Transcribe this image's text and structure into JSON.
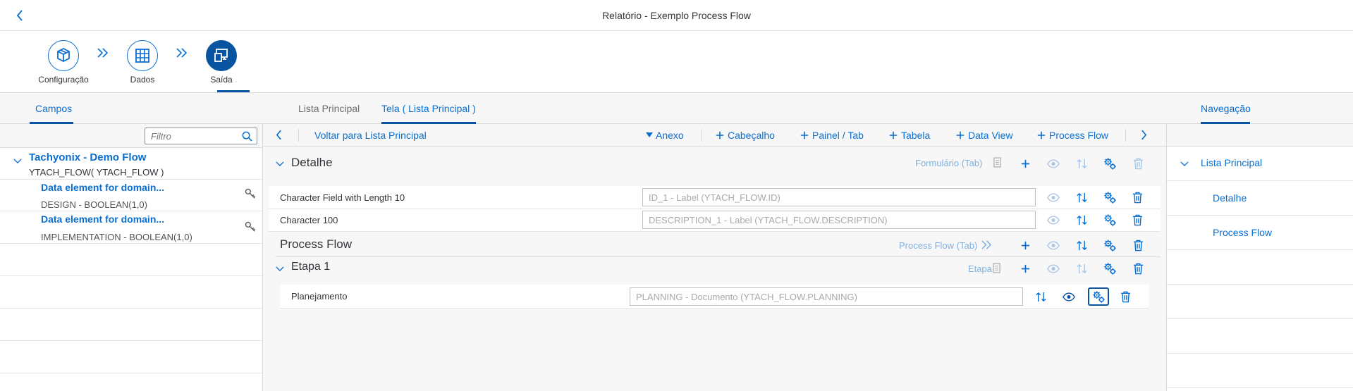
{
  "shell": {
    "title": "Relatório - Exemplo Process Flow"
  },
  "wizard": {
    "steps": [
      {
        "label": "Configuração",
        "icon": "package-icon"
      },
      {
        "label": "Dados",
        "icon": "table-grid-icon"
      },
      {
        "label": "Saída",
        "icon": "display-output-icon",
        "active": true
      }
    ]
  },
  "tabs": {
    "left": "Campos",
    "center": [
      "Lista Principal",
      "Tela ( Lista Principal )"
    ],
    "right": "Navegação"
  },
  "left_panel": {
    "filter_placeholder": "Filtro",
    "root_title": "Tachyonix - Demo Flow",
    "root_subtitle": "YTACH_FLOW( YTACH_FLOW )",
    "items": [
      {
        "title": "Data element for domain...",
        "subtitle": "DESIGN - BOOLEAN(1,0)"
      },
      {
        "title": "Data element for domain...",
        "subtitle": "IMPLEMENTATION - BOOLEAN(1,0)"
      }
    ]
  },
  "toolbar": {
    "back_label": "Voltar para Lista Principal",
    "anexo": "Anexo",
    "cabecalho": "Cabeçalho",
    "painel_tab": "Painel / Tab",
    "tabela": "Tabela",
    "data_view": "Data View",
    "process_flow": "Process Flow"
  },
  "detalhe": {
    "title": "Detalhe",
    "type_label": "Formulário (Tab)",
    "fields": [
      {
        "label": "Character Field with Length 10",
        "placeholder": "ID_1 - Label (YTACH_FLOW.ID)"
      },
      {
        "label": "Character 100",
        "placeholder": "DESCRIPTION_1 - Label (YTACH_FLOW.DESCRIPTION)"
      }
    ]
  },
  "process_flow": {
    "title": "Process Flow",
    "type_label": "Process Flow (Tab)",
    "etapa": {
      "title": "Etapa 1",
      "type_label": "Etapa",
      "fields": [
        {
          "label": "Planejamento",
          "placeholder": "PLANNING - Documento (YTACH_FLOW.PLANNING)"
        }
      ]
    }
  },
  "navigation": {
    "items": [
      "Lista Principal",
      "Detalhe",
      "Process Flow"
    ]
  },
  "colors": {
    "accent": "#0a6ed1",
    "active": "#0854a0"
  }
}
